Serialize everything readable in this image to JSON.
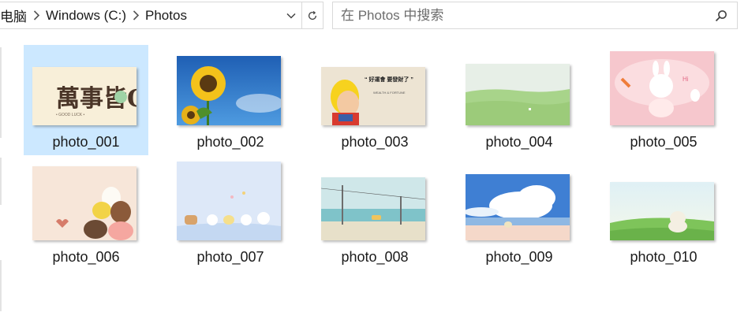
{
  "breadcrumb": {
    "items": [
      "电脑",
      "Windows (C:)",
      "Photos"
    ]
  },
  "search": {
    "placeholder": "在 Photos 中搜索"
  },
  "files": [
    {
      "name": "photo_001",
      "selected": true
    },
    {
      "name": "photo_002",
      "selected": false
    },
    {
      "name": "photo_003",
      "selected": false
    },
    {
      "name": "photo_004",
      "selected": false
    },
    {
      "name": "photo_005",
      "selected": false
    },
    {
      "name": "photo_006",
      "selected": false
    },
    {
      "name": "photo_007",
      "selected": false
    },
    {
      "name": "photo_008",
      "selected": false
    },
    {
      "name": "photo_009",
      "selected": false
    },
    {
      "name": "photo_010",
      "selected": false
    }
  ],
  "thumb_text": {
    "photo_001_logo": "萬事皆OK",
    "photo_003_quote": "“ 好運會 要發財了 ”",
    "photo_005_mark": "Hi"
  },
  "colors": {
    "selection": "#cce8ff",
    "accent": "#0078d7"
  }
}
